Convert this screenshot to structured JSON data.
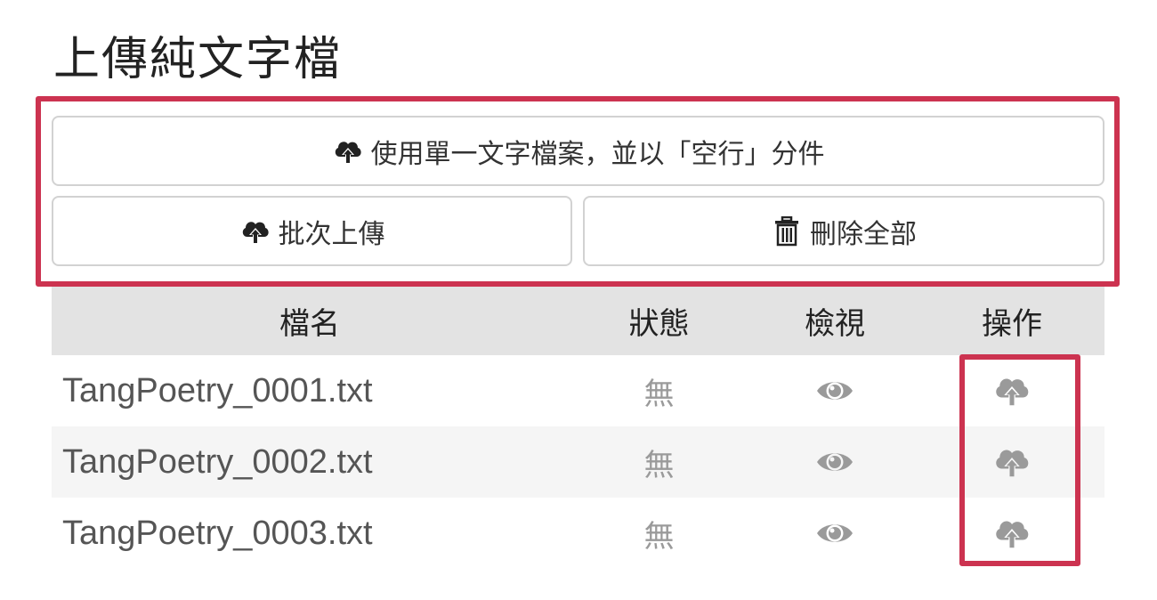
{
  "page": {
    "title": "上傳純文字檔"
  },
  "buttons": {
    "single_file": {
      "label": "使用單一文字檔案，並以「空行」分件",
      "icon": "cloud-upload-icon"
    },
    "batch_upload": {
      "label": "批次上傳",
      "icon": "cloud-upload-icon"
    },
    "delete_all": {
      "label": "刪除全部",
      "icon": "trash-icon"
    }
  },
  "table": {
    "headers": {
      "filename": "檔名",
      "status": "狀態",
      "view": "檢視",
      "action": "操作"
    },
    "rows": [
      {
        "filename": "TangPoetry_0001.txt",
        "status": "無",
        "view_icon": "eye-icon",
        "action_icon": "cloud-upload-icon"
      },
      {
        "filename": "TangPoetry_0002.txt",
        "status": "無",
        "view_icon": "eye-icon",
        "action_icon": "cloud-upload-icon"
      },
      {
        "filename": "TangPoetry_0003.txt",
        "status": "無",
        "view_icon": "eye-icon",
        "action_icon": "cloud-upload-icon"
      }
    ]
  },
  "colors": {
    "highlight": "#cc3350",
    "header_bg": "#e3e3e3",
    "alt_row_bg": "#f5f5f5",
    "muted_icon": "#9a9a9a"
  }
}
